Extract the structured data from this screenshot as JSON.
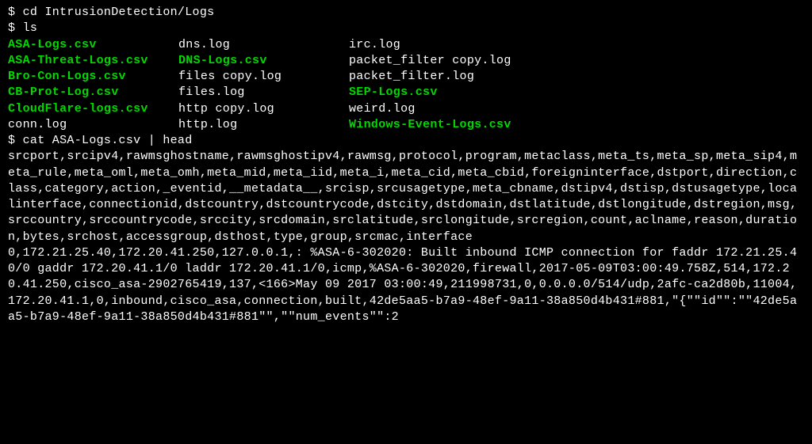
{
  "commands": {
    "cd": "$ cd IntrusionDetection/Logs",
    "ls": "$ ls",
    "cat": "$ cat ASA-Logs.csv | head"
  },
  "ls_output": [
    {
      "c1": {
        "text": "ASA-Logs.csv",
        "green": true
      },
      "c2": {
        "text": "dns.log",
        "green": false
      },
      "c3": {
        "text": "irc.log",
        "green": false
      }
    },
    {
      "c1": {
        "text": "ASA-Threat-Logs.csv",
        "green": true
      },
      "c2": {
        "text": "DNS-Logs.csv",
        "green": true
      },
      "c3": {
        "text": "packet_filter copy.log",
        "green": false
      }
    },
    {
      "c1": {
        "text": "Bro-Con-Logs.csv",
        "green": true
      },
      "c2": {
        "text": "files copy.log",
        "green": false
      },
      "c3": {
        "text": "packet_filter.log",
        "green": false
      }
    },
    {
      "c1": {
        "text": "CB-Prot-Log.csv",
        "green": true
      },
      "c2": {
        "text": "files.log",
        "green": false
      },
      "c3": {
        "text": "SEP-Logs.csv",
        "green": true
      }
    },
    {
      "c1": {
        "text": "CloudFlare-logs.csv",
        "green": true
      },
      "c2": {
        "text": "http copy.log",
        "green": false
      },
      "c3": {
        "text": "weird.log",
        "green": false
      }
    },
    {
      "c1": {
        "text": "conn.log",
        "green": false
      },
      "c2": {
        "text": "http.log",
        "green": false
      },
      "c3": {
        "text": "Windows-Event-Logs.csv",
        "green": true
      }
    }
  ],
  "cat_output": "srcport,srcipv4,rawmsghostname,rawmsghostipv4,rawmsg,protocol,program,metaclass,meta_ts,meta_sp,meta_sip4,meta_rule,meta_oml,meta_omh,meta_mid,meta_iid,meta_i,meta_cid,meta_cbid,foreigninterface,dstport,direction,class,category,action,_eventid,__metadata__,srcisp,srcusagetype,meta_cbname,dstipv4,dstisp,dstusagetype,localinterface,connectionid,dstcountry,dstcountrycode,dstcity,dstdomain,dstlatitude,dstlongitude,dstregion,msg,srccountry,srccountrycode,srccity,srcdomain,srclatitude,srclongitude,srcregion,count,aclname,reason,duration,bytes,srchost,accessgroup,dsthost,type,group,srcmac,interface\n0,172.21.25.40,172.20.41.250,127.0.0.1,: %ASA-6-302020: Built inbound ICMP connection for faddr 172.21.25.40/0 gaddr 172.20.41.1/0 laddr 172.20.41.1/0,icmp,%ASA-6-302020,firewall,2017-05-09T03:00:49.758Z,514,172.20.41.250,cisco_asa-2902765419,137,<166>May 09 2017 03:00:49,211998731,0,0.0.0.0/514/udp,2afc-ca2d80b,11004,172.20.41.1,0,inbound,cisco_asa,connection,built,42de5aa5-b7a9-48ef-9a11-38a850d4b431#881,\"{\"\"id\"\":\"\"42de5aa5-b7a9-48ef-9a11-38a850d4b431#881\"\",\"\"num_events\"\":2"
}
